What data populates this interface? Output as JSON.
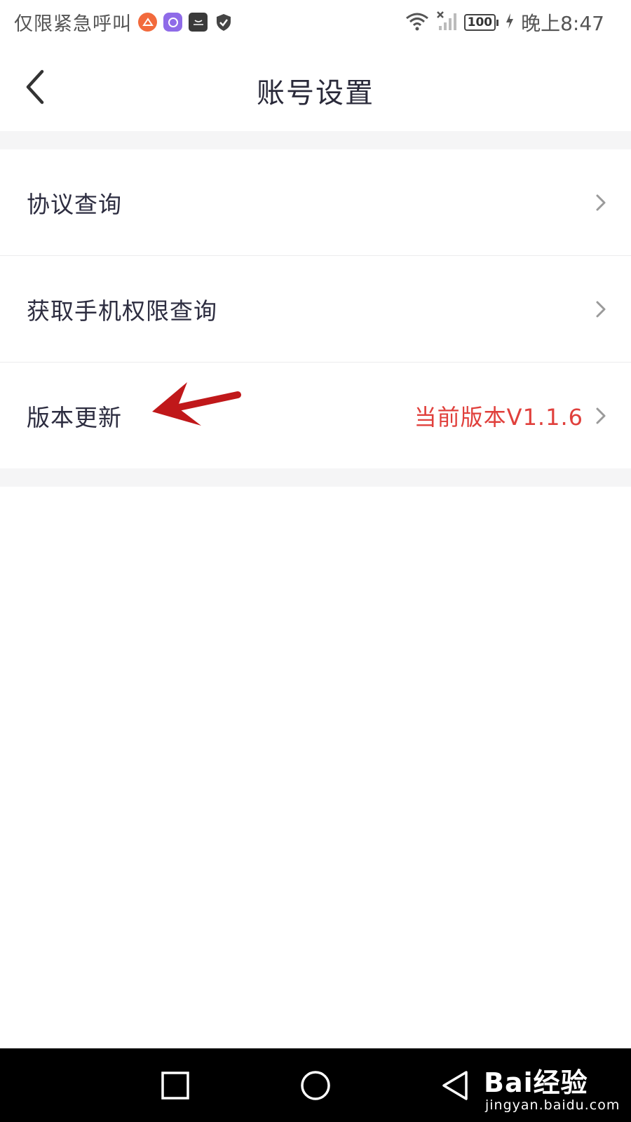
{
  "status_bar": {
    "carrier_text": "仅限紧急呼叫",
    "battery_level": "100",
    "time": "晚上8:47",
    "notification_icons": [
      "orange-app-icon",
      "purple-app-icon",
      "huawei-bag-icon",
      "shield-check-icon"
    ],
    "status_icons": [
      "wifi-icon",
      "no-signal-icon",
      "battery-icon",
      "charging-icon"
    ]
  },
  "navbar": {
    "title": "账号设置",
    "back_icon": "chevron-left-icon"
  },
  "settings": {
    "items": [
      {
        "label": "协议查询",
        "value": ""
      },
      {
        "label": "获取手机权限查询",
        "value": ""
      },
      {
        "label": "版本更新",
        "value": "当前版本V1.1.6"
      }
    ]
  },
  "bottom_nav": {
    "buttons": [
      "square-icon",
      "circle-icon",
      "triangle-back-icon"
    ]
  },
  "watermark": {
    "brand": "Bai经验",
    "url": "jingyan.baidu.com"
  },
  "colors": {
    "accent_red": "#e0403c",
    "annotation_arrow": "#c0181a",
    "gap_bg": "#f5f5f6"
  }
}
